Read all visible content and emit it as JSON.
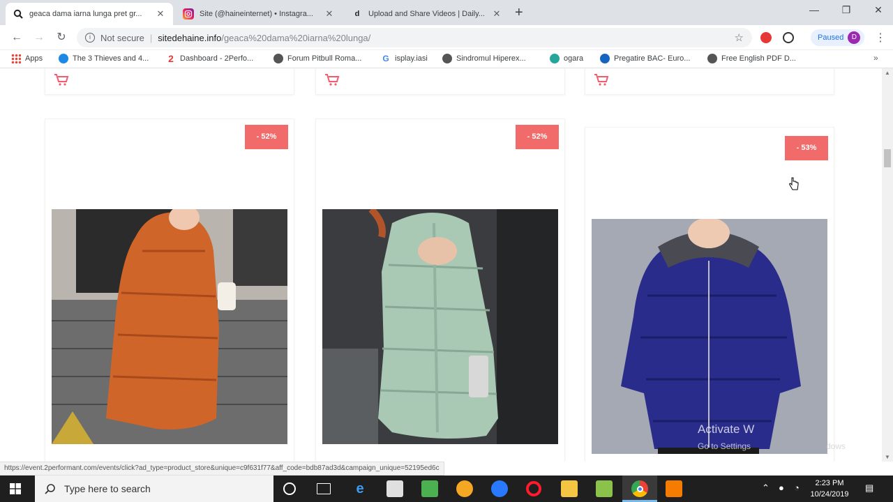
{
  "browser": {
    "tabs": [
      {
        "title": "geaca dama iarna lunga pret gr...",
        "icon": "search-icon"
      },
      {
        "title": "Site (@haineinternet) • Instagra...",
        "icon": "instagram-icon"
      },
      {
        "title": "Upload and Share Videos | Daily...",
        "icon": "dailymotion-icon"
      }
    ],
    "fav_glyphs": {
      "tab3": "d"
    },
    "new_tab": "+",
    "window_controls": {
      "minimize": "—",
      "maximize": "❐",
      "close": "✕"
    },
    "address": {
      "security": "Not secure",
      "host": "sitedehaine.info",
      "path": "/geaca%20dama%20iarna%20lunga/"
    },
    "profile": {
      "label": "Paused",
      "initial": "D"
    },
    "bookmarks": [
      {
        "label": "Apps",
        "color": "#ea4335"
      },
      {
        "label": "The 3 Thieves and 4...",
        "color": "#1e88e5"
      },
      {
        "label": "Dashboard - 2Perfo...",
        "color": "#e53935"
      },
      {
        "label": "Forum Pitbull Roma...",
        "color": "#555555"
      },
      {
        "label": "isplay.iasi",
        "color": "#4285f4"
      },
      {
        "label": "Sindromul Hiperex...",
        "color": "#555555"
      },
      {
        "label": "ogara",
        "color": "#26a69a"
      },
      {
        "label": "Pregatire BAC- Euro...",
        "color": "#1565c0"
      },
      {
        "label": "Free English PDF D...",
        "color": "#555555"
      }
    ],
    "bookmark_glyphs": {
      "dashboard": "2",
      "isplay": "G"
    }
  },
  "page": {
    "products": [
      {
        "discount": "- 52%",
        "image_alt": "orange hooded long puffer jacket"
      },
      {
        "discount": "- 52%",
        "image_alt": "mint green hooded long puffer jacket"
      },
      {
        "discount": "- 53%",
        "image_alt": "navy blue short puffer jacket with fur hood"
      }
    ],
    "watermark": {
      "line1": "Activate W",
      "line2": "Go to Settings",
      "line3": "dows"
    }
  },
  "status_url": "https://event.2performant.com/events/click?ad_type=product_store&unique=c9f631f77&aff_code=bdb87ad3d&campaign_unique=52195ed6c",
  "taskbar": {
    "search_placeholder": "Type here to search",
    "time": "2:23 PM",
    "date": "10/24/2019"
  },
  "colors": {
    "accent": "#f26b6b",
    "cart": "#f25c6e"
  }
}
